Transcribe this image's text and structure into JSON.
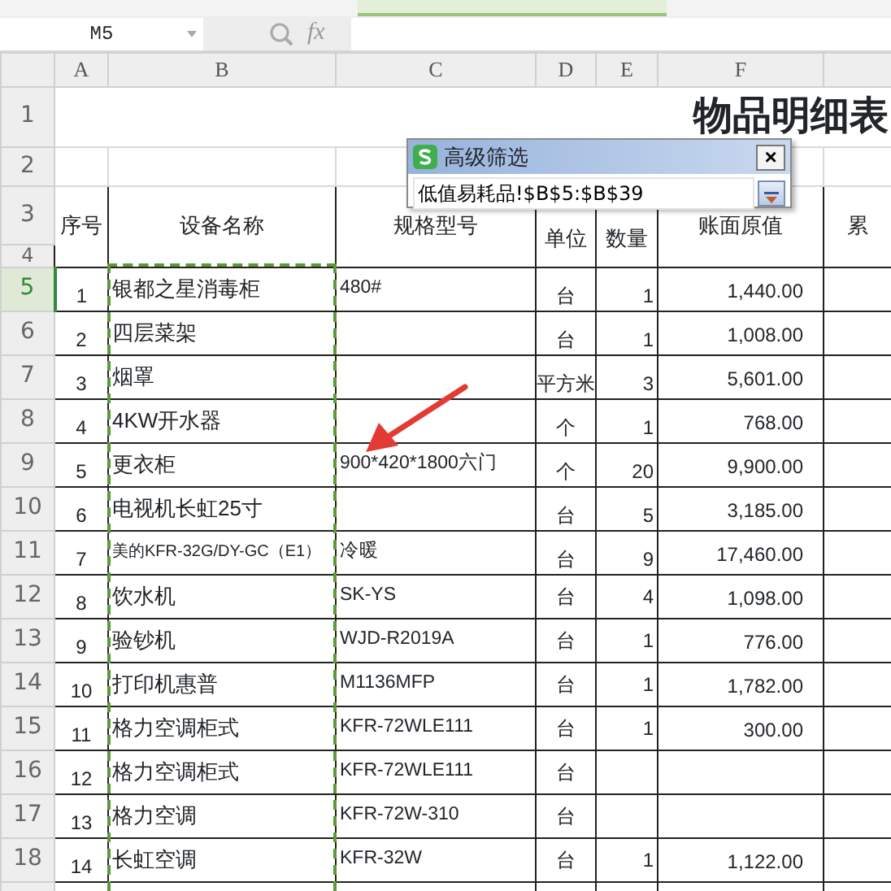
{
  "formula_bar": {
    "name_box": "M5",
    "function_label": "fx"
  },
  "column_headers": [
    "A",
    "B",
    "C",
    "D",
    "E",
    "F"
  ],
  "title": {
    "row_number": "1",
    "text": "物品明细表"
  },
  "blank_row": {
    "row_number": "2"
  },
  "header": {
    "row_numbers": [
      "3",
      "4"
    ],
    "columns": [
      "序号",
      "设备名称",
      "规格型号",
      "单位",
      "数量",
      "账面原值",
      "累"
    ]
  },
  "rows": [
    {
      "row_number": "5",
      "active": true,
      "no": "1",
      "name": "银都之星消毒柜",
      "model": "480#",
      "unit": "台",
      "qty": "1",
      "value": "1,440.00"
    },
    {
      "row_number": "6",
      "active": false,
      "no": "2",
      "name": "四层菜架",
      "model": "",
      "unit": "台",
      "qty": "1",
      "value": "1,008.00"
    },
    {
      "row_number": "7",
      "active": false,
      "no": "3",
      "name": "烟罩",
      "model": "",
      "unit": "平方米",
      "qty": "3",
      "value": "5,601.00"
    },
    {
      "row_number": "8",
      "active": false,
      "no": "4",
      "name": "4KW开水器",
      "model": "",
      "unit": "个",
      "qty": "1",
      "value": "768.00"
    },
    {
      "row_number": "9",
      "active": false,
      "no": "5",
      "name": "更衣柜",
      "model": "900*420*1800六门",
      "unit": "个",
      "qty": "20",
      "value": "9,900.00"
    },
    {
      "row_number": "10",
      "active": false,
      "no": "6",
      "name": "电视机长虹25寸",
      "model": "",
      "unit": "台",
      "qty": "5",
      "value": "3,185.00"
    },
    {
      "row_number": "11",
      "active": false,
      "no": "7",
      "name": "美的KFR-32G/DY-GC（E1）",
      "model": "冷暖",
      "unit": "台",
      "qty": "9",
      "value": "17,460.00"
    },
    {
      "row_number": "12",
      "active": false,
      "no": "8",
      "name": "饮水机",
      "model": "SK-YS",
      "unit": "台",
      "qty": "4",
      "value": "1,098.00"
    },
    {
      "row_number": "13",
      "active": false,
      "no": "9",
      "name": "验钞机",
      "model": "WJD-R2019A",
      "unit": "台",
      "qty": "1",
      "value": "776.00"
    },
    {
      "row_number": "14",
      "active": false,
      "no": "10",
      "name": "打印机惠普",
      "model": "M1136MFP",
      "unit": "台",
      "qty": "1",
      "value": "1,782.00"
    },
    {
      "row_number": "15",
      "active": false,
      "no": "11",
      "name": "格力空调柜式",
      "model": "KFR-72WLE111",
      "unit": "台",
      "qty": "1",
      "value": "300.00"
    },
    {
      "row_number": "16",
      "active": false,
      "no": "12",
      "name": "格力空调柜式",
      "model": "KFR-72WLE111",
      "unit": "台",
      "qty": "",
      "value": ""
    },
    {
      "row_number": "17",
      "active": false,
      "no": "13",
      "name": "格力空调",
      "model": "KFR-72W-310",
      "unit": "台",
      "qty": "",
      "value": ""
    },
    {
      "row_number": "18",
      "active": false,
      "no": "14",
      "name": "长虹空调",
      "model": "KFR-32W",
      "unit": "台",
      "qty": "1",
      "value": "1,122.00"
    }
  ],
  "dialog": {
    "title": "高级筛选",
    "close_label": "×",
    "range": "低值易耗品!$B$5:$B$39"
  }
}
